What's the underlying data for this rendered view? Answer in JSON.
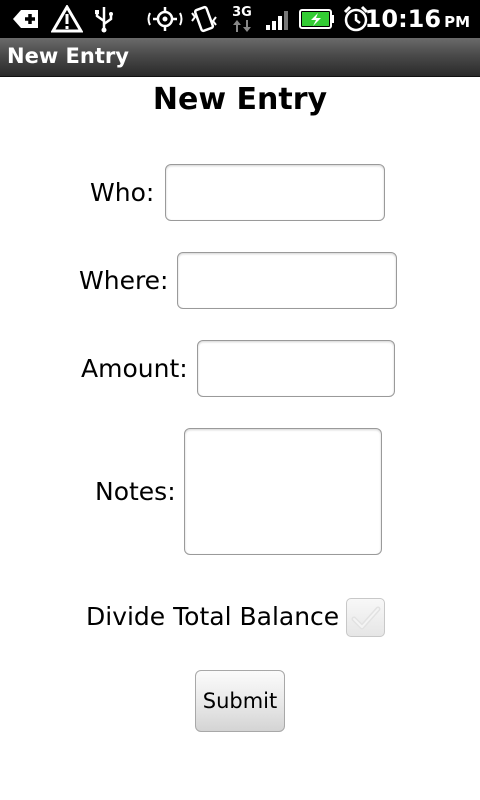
{
  "status_bar": {
    "time": "10:16",
    "ampm": "PM",
    "network_label": "3G",
    "icons": [
      "back-notification-icon",
      "warning-icon",
      "usb-icon",
      "gps-icon",
      "vibrate-icon",
      "3g-data-icon",
      "signal-icon",
      "battery-charging-icon",
      "alarm-icon"
    ],
    "battery_color": "#33cc33"
  },
  "title_bar": {
    "title": "New Entry"
  },
  "form": {
    "heading": "New Entry",
    "who_label": "Who:",
    "who_value": "",
    "where_label": "Where:",
    "where_value": "",
    "amount_label": "Amount:",
    "amount_value": "",
    "notes_label": "Notes:",
    "notes_value": "",
    "divide_label": "Divide Total Balance",
    "divide_checked": false,
    "submit_label": "Submit"
  }
}
